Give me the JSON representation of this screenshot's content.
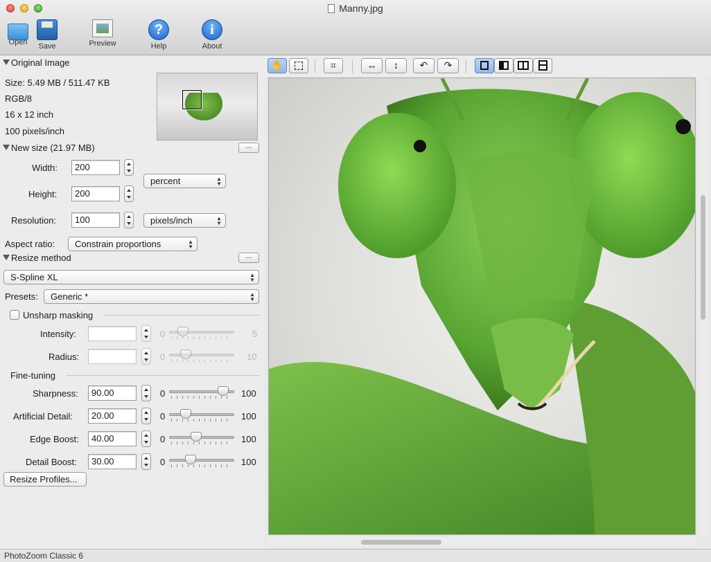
{
  "window": {
    "title": "Manny.jpg"
  },
  "toolbar": {
    "open": "Open",
    "save": "Save",
    "preview": "Preview",
    "help": "Help",
    "about": "About"
  },
  "original": {
    "section_label": "Original Image",
    "size": "Size: 5.49 MB / 511.47 KB",
    "mode": "RGB/8",
    "dimensions": "16 x 12 inch",
    "resolution": "100 pixels/inch",
    "more_label": "..."
  },
  "new_size": {
    "section_label": "New size (21.97 MB)",
    "width_label": "Width:",
    "width_value": "200",
    "height_label": "Height:",
    "height_value": "200",
    "unit": "percent",
    "resolution_label": "Resolution:",
    "resolution_value": "100",
    "resolution_unit": "pixels/inch",
    "aspect_label": "Aspect ratio:",
    "aspect_value": "Constrain proportions"
  },
  "resize_method": {
    "section_label": "Resize method",
    "more_label": "...",
    "method": "S-Spline XL",
    "presets_label": "Presets:",
    "presets_value": "Generic *"
  },
  "unsharp": {
    "label": "Unsharp masking",
    "checked": false,
    "intensity_label": "Intensity:",
    "intensity_value": "",
    "intensity_min": "0",
    "intensity_max": "5",
    "intensity_level": 0.15,
    "radius_label": "Radius:",
    "radius_value": "",
    "radius_min": "0",
    "radius_max": "10",
    "radius_level": 0.2
  },
  "fine_tuning": {
    "label": "Fine-tuning",
    "rows": [
      {
        "label": "Sharpness:",
        "value": "90.00",
        "min": "0",
        "max": "100",
        "level": 0.9
      },
      {
        "label": "Artificial Detail:",
        "value": "20.00",
        "min": "0",
        "max": "100",
        "level": 0.2
      },
      {
        "label": "Edge Boost:",
        "value": "40.00",
        "min": "0",
        "max": "100",
        "level": 0.4
      },
      {
        "label": "Detail Boost:",
        "value": "30.00",
        "min": "0",
        "max": "100",
        "level": 0.3
      }
    ]
  },
  "resize_profiles_label": "Resize Profiles...",
  "status": {
    "text": "PhotoZoom Classic 6"
  }
}
